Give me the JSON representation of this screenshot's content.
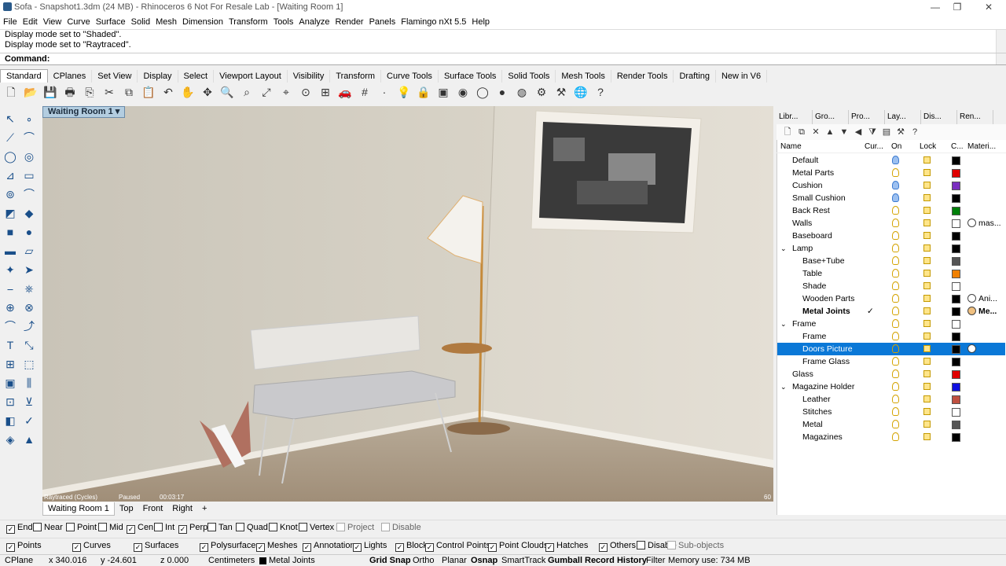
{
  "window": {
    "title": "Sofa - Snapshot1.3dm (24 MB) - Rhinoceros 6 Not For Resale Lab - [Waiting Room 1]",
    "minimize": "—",
    "maximize": "❐",
    "close": "✕"
  },
  "menu": [
    "File",
    "Edit",
    "View",
    "Curve",
    "Surface",
    "Solid",
    "Mesh",
    "Dimension",
    "Transform",
    "Tools",
    "Analyze",
    "Render",
    "Panels",
    "Flamingo nXt 5.5",
    "Help"
  ],
  "command_history": [
    "Display mode set to \"Shaded\".",
    "Display mode set to \"Raytraced\"."
  ],
  "command": {
    "label": "Command:",
    "value": ""
  },
  "toolbar_tabs": [
    "Standard",
    "CPlanes",
    "Set View",
    "Display",
    "Select",
    "Viewport Layout",
    "Visibility",
    "Transform",
    "Curve Tools",
    "Surface Tools",
    "Solid Tools",
    "Mesh Tools",
    "Render Tools",
    "Drafting",
    "New in V6"
  ],
  "toolbar_icons": [
    "new-file-icon",
    "open-icon",
    "save-icon",
    "print-icon",
    "import-icon",
    "cut-icon",
    "copy-icon",
    "paste-icon",
    "undo-icon",
    "pan-icon",
    "rotate-view-icon",
    "zoom-icon",
    "zoom-window-icon",
    "zoom-extents-icon",
    "zoom-selected-icon",
    "zoom-dynamic-icon",
    "four-viewports-icon",
    "car-icon",
    "grid-icon",
    "point-icon",
    "light-icon",
    "lock-icon",
    "object-properties-icon",
    "color-icon",
    "wireframe-icon",
    "shaded-icon",
    "render-icon",
    "settings-icon",
    "options-icon",
    "globe-icon",
    "help-icon"
  ],
  "viewport": {
    "title": "Waiting Room 1",
    "status": {
      "mode": "Raytraced (Cycles)",
      "state": "Paused",
      "time": "00:03:17",
      "passes": "60"
    },
    "tabs": [
      "Waiting Room 1",
      "Top",
      "Front",
      "Right"
    ],
    "add_tab": "+"
  },
  "panel": {
    "tabs": [
      "Libr...",
      "Gro...",
      "Pro...",
      "Lay...",
      "Dis...",
      "Ren..."
    ],
    "headers": {
      "name": "Name",
      "current": "Cur...",
      "on": "On",
      "lock": "Lock",
      "color": "C...",
      "material": "Materi..."
    },
    "layers": [
      {
        "name": "Default",
        "level": 0,
        "color": "#000000",
        "on_color": "blue"
      },
      {
        "name": "Metal Parts",
        "level": 0,
        "color": "#e00000"
      },
      {
        "name": "Cushion",
        "level": 0,
        "color": "#7a2fc0",
        "on_color": "blue"
      },
      {
        "name": "Small Cushion",
        "level": 0,
        "color": "#000000",
        "on_color": "blue"
      },
      {
        "name": "Back Rest",
        "level": 0,
        "color": "#00800a"
      },
      {
        "name": "Walls",
        "level": 0,
        "color": "#ffffff",
        "material": "mas..."
      },
      {
        "name": "Baseboard",
        "level": 0,
        "color": "#000000"
      },
      {
        "name": "Lamp",
        "level": 0,
        "color": "#000000",
        "expanded": "⌄"
      },
      {
        "name": "Base+Tube",
        "level": 1,
        "color": "#555555"
      },
      {
        "name": "Table",
        "level": 1,
        "color": "#f08000"
      },
      {
        "name": "Shade",
        "level": 1,
        "color": "#ffffff"
      },
      {
        "name": "Wooden Parts",
        "level": 1,
        "color": "#000000",
        "material": "Ani..."
      },
      {
        "name": "Metal Joints",
        "level": 1,
        "color": "#000000",
        "material": "Me...",
        "current": "✓",
        "bold": "yes"
      },
      {
        "name": "Frame",
        "level": 0,
        "color": "#ffffff",
        "expanded": "⌄"
      },
      {
        "name": "Frame",
        "level": 1,
        "color": "#000000"
      },
      {
        "name": "Doors Picture",
        "level": 1,
        "color": "#000000",
        "selected": "yes",
        "material": ""
      },
      {
        "name": "Frame Glass",
        "level": 1,
        "color": "#000000"
      },
      {
        "name": "Glass",
        "level": 0,
        "color": "#e00000"
      },
      {
        "name": "Magazine Holder",
        "level": 0,
        "color": "#1010e0",
        "expanded": "⌄"
      },
      {
        "name": "Leather",
        "level": 1,
        "color": "#c05040"
      },
      {
        "name": "Stitches",
        "level": 1,
        "color": "#ffffff"
      },
      {
        "name": "Metal",
        "level": 1,
        "color": "#555555"
      },
      {
        "name": "Magazines",
        "level": 1,
        "color": "#000000"
      }
    ]
  },
  "osnaps": [
    {
      "label": "End",
      "checked": true
    },
    {
      "label": "Near",
      "checked": false
    },
    {
      "label": "Point",
      "checked": false
    },
    {
      "label": "Mid",
      "checked": false
    },
    {
      "label": "Cen",
      "checked": true
    },
    {
      "label": "Int",
      "checked": false
    },
    {
      "label": "Perp",
      "checked": true
    },
    {
      "label": "Tan",
      "checked": false
    },
    {
      "label": "Quad",
      "checked": false
    },
    {
      "label": "Knot",
      "checked": false
    },
    {
      "label": "Vertex",
      "checked": false
    },
    {
      "label": "Project",
      "checked": false,
      "disabled": true
    },
    {
      "label": "Disable",
      "checked": false,
      "disabled": true
    }
  ],
  "filters": [
    {
      "label": "Points",
      "checked": true
    },
    {
      "label": "Curves",
      "checked": true
    },
    {
      "label": "Surfaces",
      "checked": true
    },
    {
      "label": "Polysurfaces",
      "checked": true
    },
    {
      "label": "Meshes",
      "checked": true
    },
    {
      "label": "Annotations",
      "checked": true
    },
    {
      "label": "Lights",
      "checked": true
    },
    {
      "label": "Blocks",
      "checked": true
    },
    {
      "label": "Control Points",
      "checked": true
    },
    {
      "label": "Point Clouds",
      "checked": true
    },
    {
      "label": "Hatches",
      "checked": true
    },
    {
      "label": "Others",
      "checked": true
    },
    {
      "label": "Disable",
      "checked": false
    },
    {
      "label": "Sub-objects",
      "checked": false,
      "disabled": true
    }
  ],
  "status": {
    "cplane": "CPlane",
    "x": "x 340.016",
    "y": "y -24.601",
    "z": "z 0.000",
    "units": "Centimeters",
    "layer": "Metal Joints",
    "grid_snap": "Grid Snap",
    "ortho": "Ortho",
    "planar": "Planar",
    "osnap": "Osnap",
    "smarttrack": "SmartTrack",
    "gumball": "Gumball",
    "record_history": "Record History",
    "filter": "Filter",
    "memory": "Memory use: 734 MB"
  }
}
